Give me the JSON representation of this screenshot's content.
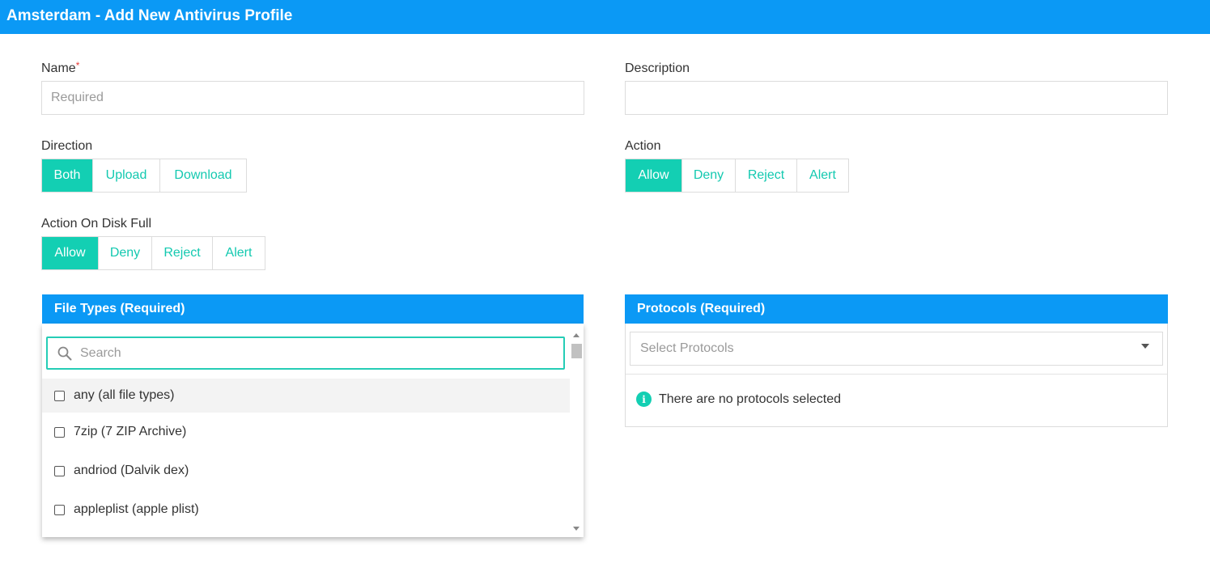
{
  "header": {
    "title": "Amsterdam - Add New Antivirus Profile"
  },
  "form": {
    "name": {
      "label": "Name",
      "required_mark": "*",
      "placeholder": "Required",
      "value": ""
    },
    "description": {
      "label": "Description",
      "placeholder": "",
      "value": ""
    },
    "direction": {
      "label": "Direction",
      "options": [
        "Both",
        "Upload",
        "Download"
      ],
      "selected": "Both"
    },
    "action": {
      "label": "Action",
      "options": [
        "Allow",
        "Deny",
        "Reject",
        "Alert"
      ],
      "selected": "Allow"
    },
    "action_on_disk_full": {
      "label": "Action On Disk Full",
      "options": [
        "Allow",
        "Deny",
        "Reject",
        "Alert"
      ],
      "selected": "Allow"
    }
  },
  "file_types": {
    "title": "File Types (Required)",
    "search_placeholder": "Search",
    "options": [
      {
        "label": "any (all file types)",
        "checked": false
      },
      {
        "label": "7zip (7 ZIP Archive)",
        "checked": false
      },
      {
        "label": "andriod (Dalvik dex)",
        "checked": false
      },
      {
        "label": "appleplist (apple plist)",
        "checked": false
      }
    ]
  },
  "protocols": {
    "title": "Protocols (Required)",
    "select_placeholder": "Select Protocols",
    "empty_message": "There are no protocols selected",
    "info_icon_glyph": "i"
  },
  "colors": {
    "brand_blue": "#0b99f5",
    "accent_teal": "#13cfb3",
    "required_red": "#e53935"
  }
}
